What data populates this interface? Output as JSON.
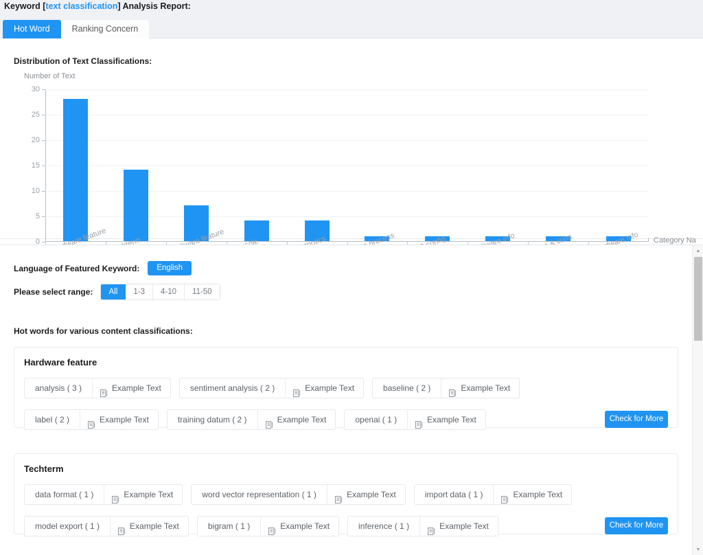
{
  "header": {
    "title_prefix": "Keyword [",
    "keyword": "text classification",
    "title_suffix": "] Analysis Report:",
    "tabs": [
      {
        "label": "Hot Word",
        "active": true
      },
      {
        "label": "Ranking Concern",
        "active": false
      }
    ]
  },
  "chart_section": {
    "heading": "Distribution of Text Classifications:"
  },
  "chart_data": {
    "type": "bar",
    "title": "Distribution of Text Classifications:",
    "xlabel": "Category Na",
    "ylabel": "Number of Text",
    "categories": [
      "Hardware feature",
      "Techterm",
      "Software feature",
      "Console",
      "Diagnotics",
      "Data process",
      "iOS config",
      "Software info",
      "Pros & cons",
      "Hardware info"
    ],
    "values": [
      28,
      14,
      7,
      4,
      4,
      1,
      1,
      1,
      1,
      1
    ],
    "ylim": [
      0,
      30
    ],
    "yticks": [
      0,
      5,
      10,
      15,
      20,
      25,
      30
    ],
    "grid": true,
    "legend": null,
    "bar_color": "#2094f3"
  },
  "controls": {
    "language_label": "Language of Featured Keyword:",
    "language_value": "English",
    "range_label": "Please select range:",
    "range_options": [
      {
        "label": "All",
        "active": true
      },
      {
        "label": "1-3",
        "active": false
      },
      {
        "label": "4-10",
        "active": false
      },
      {
        "label": "11-50",
        "active": false
      }
    ]
  },
  "hot_words_section": {
    "title": "Hot words for various content classifications:",
    "example_label": "Example Text",
    "example_icon": "document-icon",
    "more_label": "Check for More",
    "cards": [
      {
        "title": "Hardware feature",
        "rows": [
          [
            {
              "word": "analysis ( 3 )"
            },
            {
              "word": "sentiment analysis ( 2 )"
            },
            {
              "word": "baseline ( 2 )"
            }
          ],
          [
            {
              "word": "label ( 2 )"
            },
            {
              "word": "training datum ( 2 )"
            },
            {
              "word": "openai ( 1 )"
            }
          ]
        ]
      },
      {
        "title": "Techterm",
        "rows": [
          [
            {
              "word": "data format ( 1 )"
            },
            {
              "word": "word vector representation ( 1 )"
            },
            {
              "word": "import data ( 1 )"
            }
          ],
          [
            {
              "word": "model export ( 1 )"
            },
            {
              "word": "bigram ( 1 )"
            },
            {
              "word": "inference ( 1 )"
            }
          ]
        ]
      }
    ]
  },
  "scrollbar": {
    "up_arrow": "▲",
    "down_arrow": "▼"
  },
  "colors": {
    "accent": "#2094f3",
    "header_bg": "#eff1f5",
    "text": "#1b1b1b",
    "muted": "#9aa0a6"
  }
}
